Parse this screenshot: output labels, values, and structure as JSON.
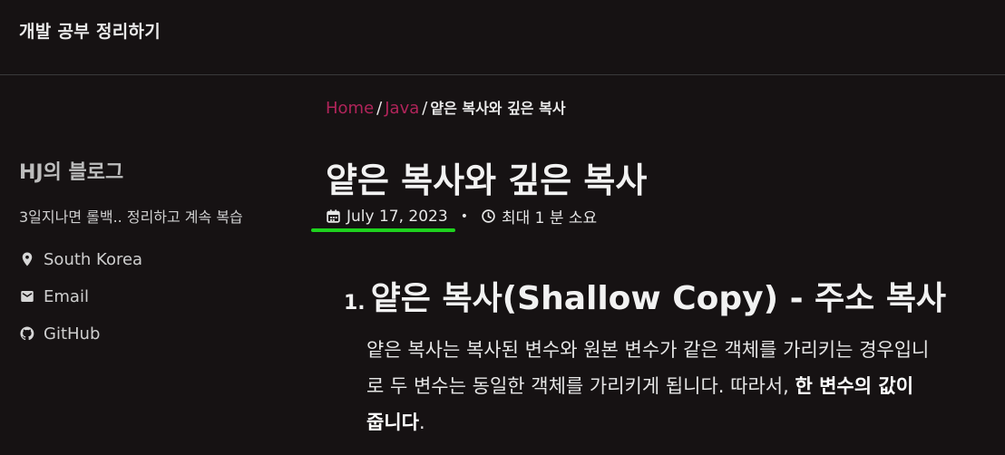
{
  "masthead": {
    "site_title": "개발 공부 정리하기"
  },
  "breadcrumb": {
    "items": [
      "Home",
      "Java"
    ],
    "separator": "/",
    "current": "얕은 복사와 깊은 복사"
  },
  "sidebar": {
    "author_name": "HJ의 블로그",
    "author_bio": "3일지나면 롤백.. 정리하고 계속 복습",
    "links": [
      {
        "label": "South Korea",
        "icon": "map-marker-icon"
      },
      {
        "label": "Email",
        "icon": "envelope-icon"
      },
      {
        "label": "GitHub",
        "icon": "github-icon"
      }
    ]
  },
  "page": {
    "title": "얕은 복사와 깊은 복사",
    "date": "July 17, 2023",
    "meta_separator": "•",
    "read_time": "최대 1 분 소요"
  },
  "content": {
    "section_number": "1.",
    "section_heading": "얕은 복사(Shallow Copy) - 주소 복사",
    "lines": [
      {
        "text": "얕은 복사는 복사된 변수와 원본 변수가 같은 객체를 가리키는 경우입니"
      },
      {
        "text": "로 두 변수는 동일한 객체를 가리키게 됩니다. 따라서, ",
        "bold": "한 변수의 값이"
      },
      {
        "text": "",
        "bold": "줍니다",
        "tail": "."
      }
    ]
  },
  "colors": {
    "background": "#161213",
    "link": "#b0245a",
    "highlight_underline": "#1ed21e"
  }
}
